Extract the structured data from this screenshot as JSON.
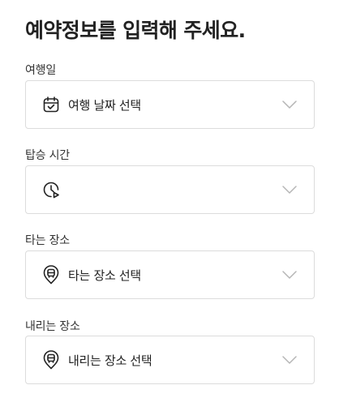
{
  "page": {
    "title": "예약정보를 입력해 주세요."
  },
  "fields": [
    {
      "label": "여행일",
      "value": "여행 날짜 선택",
      "icon": "calendar-icon"
    },
    {
      "label": "탑승 시간",
      "value": "",
      "icon": "clock-icon"
    },
    {
      "label": "타는 장소",
      "value": "타는 장소 선택",
      "icon": "bus-location-pin-icon"
    },
    {
      "label": "내리는 장소",
      "value": "내리는 장소 선택",
      "icon": "bus-location-pin-icon"
    }
  ],
  "colors": {
    "border": "#dcdcdc",
    "chevron": "#b5b5b5",
    "text": "#222222"
  }
}
